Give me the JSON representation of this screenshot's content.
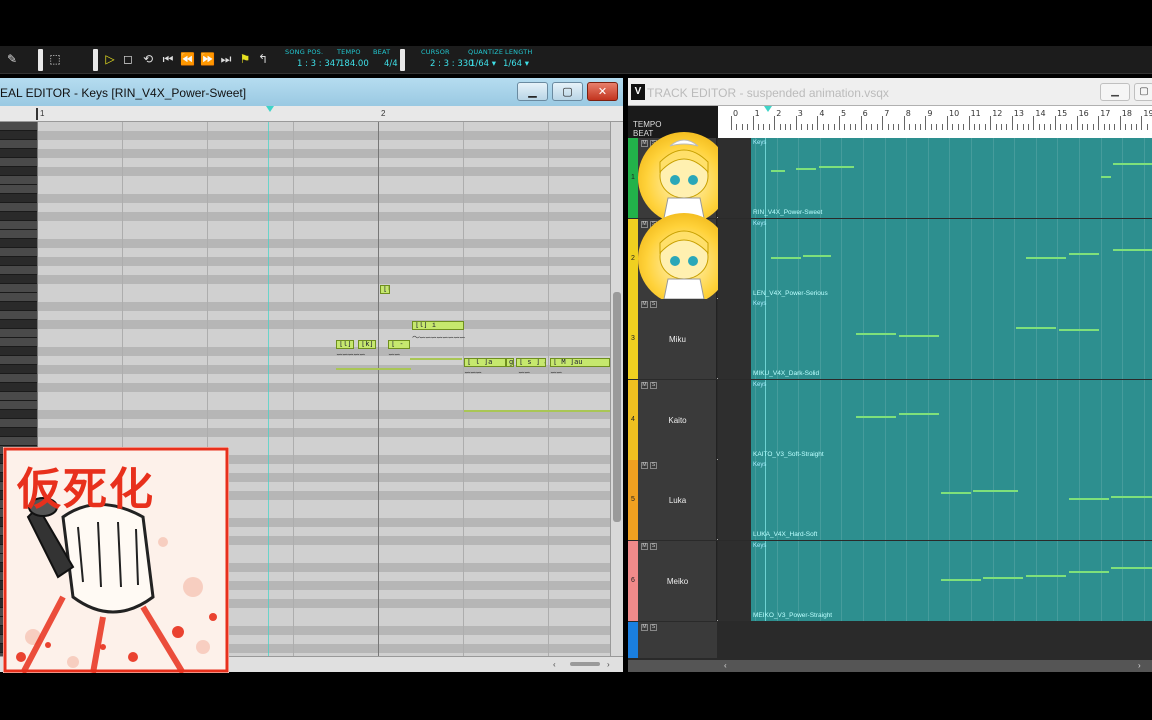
{
  "toolbar": {
    "song_pos_label": "SONG POS.",
    "song_pos": "1 : 3 : 347",
    "tempo_label": "TEMPO",
    "tempo": "184.00",
    "beat_label": "BEAT",
    "beat": "4/4",
    "cursor_label": "CURSOR",
    "cursor": "2 : 3 : 330",
    "quantize_label": "QUANTIZE",
    "quantize": "1/64 ▾",
    "length_label": "LENGTH",
    "length": "1/64 ▾",
    "accent_color": "#22c7d0"
  },
  "piano_roll": {
    "title": "EAL EDITOR - Keys [RIN_V4X_Power-Sweet]",
    "ruler": {
      "bar1": "1",
      "bar2": "2"
    },
    "notes": [
      {
        "label": "[l]"
      },
      {
        "label": "[l] i"
      },
      {
        "label": "[l] i"
      },
      {
        "label": "[k]"
      },
      {
        "label": "[ -"
      },
      {
        "label": "[ l ]a"
      },
      {
        "label": "g"
      },
      {
        "label": "[ s ] a"
      },
      {
        "label": "[ M ]au"
      }
    ],
    "window_buttons": {
      "minimize": "▁",
      "maximize": "▢",
      "close": "✕"
    }
  },
  "album_art": {
    "title": "仮死化",
    "bg_text": "仮死化",
    "accent": "#e8301c"
  },
  "track_editor": {
    "logo": "V",
    "title": "TRACK EDITOR - suspended animation.vsqx",
    "tempo_label": "TEMPO",
    "beat_label": "BEAT",
    "ruler_numbers": [
      "0",
      "1",
      "2",
      "3",
      "4",
      "5",
      "6",
      "7",
      "8",
      "9",
      "10",
      "11",
      "12",
      "13",
      "14",
      "15",
      "16",
      "17",
      "18",
      "19"
    ],
    "mute_label": "M",
    "solo_label": "S",
    "tracks": [
      {
        "num": "1",
        "name": "",
        "part": "Keys",
        "singer": "RIN_V4X_Power-Sweet",
        "color": "#22b24a"
      },
      {
        "num": "2",
        "name": "",
        "part": "Keys",
        "singer": "LEN_V4X_Power-Serious",
        "color": "#f0d020"
      },
      {
        "num": "3",
        "name": "Miku",
        "part": "Keys",
        "singer": "MIKU_V4X_Dark-Solid",
        "color": "#f0d020"
      },
      {
        "num": "4",
        "name": "Kaito",
        "part": "Keys",
        "singer": "KAITO_V3_Soft-Straight",
        "color": "#f0c020"
      },
      {
        "num": "5",
        "name": "Luka",
        "part": "Keys",
        "singer": "LUKA_V4X_Hard-Soft",
        "color": "#f0a020"
      },
      {
        "num": "6",
        "name": "Meiko",
        "part": "Keys",
        "singer": "MEIKO_V3_Power-Straight",
        "color": "#f08a8a"
      }
    ],
    "window_buttons": {
      "minimize": "▁",
      "maximize": "▢"
    }
  }
}
